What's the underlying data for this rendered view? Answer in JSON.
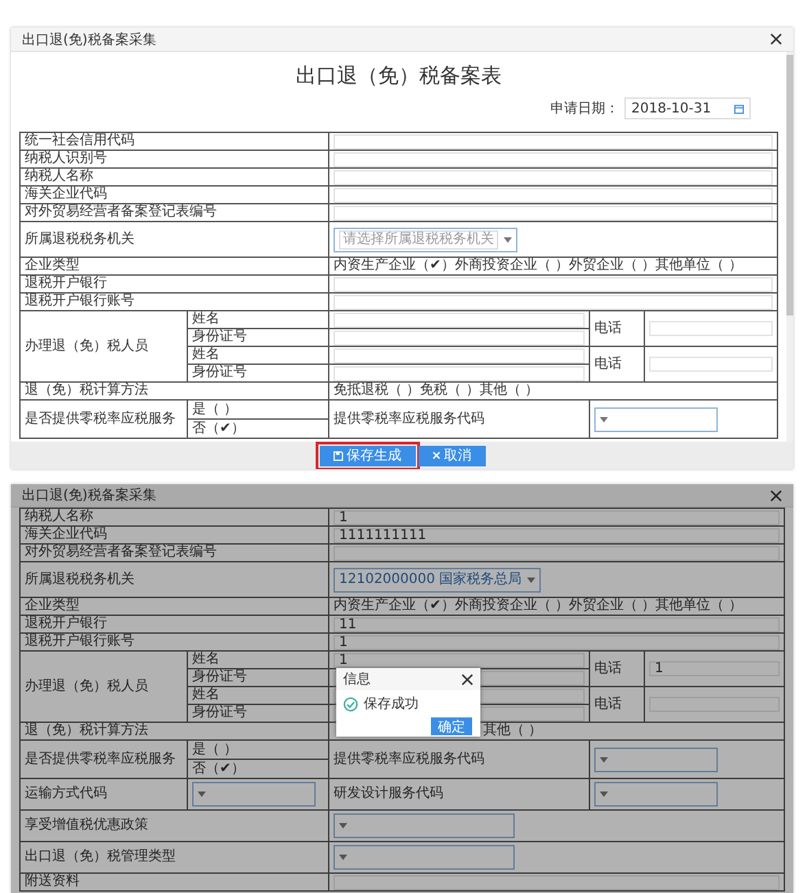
{
  "upper": {
    "dialog_title": "出口退(免)税备案采集",
    "heading": "出口退（免）税备案表",
    "date_label": "申请日期：",
    "date_value": "2018-10-31",
    "rows": [
      {
        "kind": "text",
        "label": "统一社会信用代码"
      },
      {
        "kind": "text",
        "label": "纳税人识别号"
      },
      {
        "kind": "text",
        "label": "纳税人名称"
      },
      {
        "kind": "text",
        "label": "海关企业代码"
      },
      {
        "kind": "text",
        "label": "对外贸易经营者备案登记表编号"
      },
      {
        "kind": "select",
        "label": "所属退税税务机关",
        "placeholder": "请选择所属退税税务机关"
      },
      {
        "kind": "choice",
        "label": "企业类型",
        "value": "内资生产企业（✔）外商投资企业（ ）外贸企业（ ）其他单位（ ）"
      },
      {
        "kind": "text",
        "label": "退税开户银行"
      },
      {
        "kind": "text",
        "label": "退税开户银行账号"
      },
      {
        "kind": "persons",
        "label": "办理退（免）税人员",
        "people": [
          {
            "fields": [
              {
                "label": "姓名"
              },
              {
                "label": "身份证号"
              }
            ],
            "phone_label": "电话"
          },
          {
            "fields": [
              {
                "label": "姓名"
              },
              {
                "label": "身份证号"
              }
            ],
            "phone_label": "电话"
          }
        ]
      },
      {
        "kind": "choice",
        "label": "退（免）税计算方法",
        "value": "免抵退税（ ）免税（ ）其他（ ）"
      },
      {
        "kind": "yesno",
        "label": "是否提供零税率应税服务",
        "options": [
          "是（ ）",
          "否（✔）"
        ],
        "right_label": "提供零税率应税服务代码"
      }
    ],
    "buttons": [
      {
        "label": "保存生成",
        "kind": "save",
        "highlighted": true
      },
      {
        "label": "取消",
        "kind": "cancel",
        "highlighted": false
      }
    ]
  },
  "lower": {
    "dialog_title": "出口退(免)税备案采集",
    "rows": [
      {
        "kind": "text",
        "label": "纳税人名称",
        "value": "1"
      },
      {
        "kind": "text",
        "label": "海关企业代码",
        "value": "1111111111"
      },
      {
        "kind": "text",
        "label": "对外贸易经营者备案登记表编号"
      },
      {
        "kind": "select",
        "label": "所属退税税务机关",
        "value": "12102000000 国家税务总局"
      },
      {
        "kind": "choice",
        "label": "企业类型",
        "value": "内资生产企业（✔）外商投资企业（ ）外贸企业（ ）其他单位（ ）"
      },
      {
        "kind": "text",
        "label": "退税开户银行",
        "value": "11"
      },
      {
        "kind": "text",
        "label": "退税开户银行账号",
        "value": "1"
      },
      {
        "kind": "persons",
        "label": "办理退（免）税人员",
        "people": [
          {
            "fields": [
              {
                "label": "姓名",
                "value": "1"
              },
              {
                "label": "身份证号"
              }
            ],
            "phone_label": "电话",
            "phone_value": "1"
          },
          {
            "fields": [
              {
                "label": "姓名"
              },
              {
                "label": "身份证号"
              }
            ],
            "phone_label": "电话"
          }
        ]
      },
      {
        "kind": "covered_choice",
        "label": "退（免）税计算方法",
        "value": "其他（ ）"
      },
      {
        "kind": "yesno",
        "label": "是否提供零税率应税服务",
        "options": [
          "是（ ）",
          "否（✔）"
        ],
        "right_label": "提供零税率应税服务代码"
      },
      {
        "kind": "pair_select",
        "label": "运输方式代码",
        "right_label": "研发设计服务代码"
      },
      {
        "kind": "select",
        "label": "享受增值税优惠政策"
      },
      {
        "kind": "select",
        "label": "出口退（免）税管理类型"
      },
      {
        "kind": "text",
        "label": "附送资料"
      }
    ],
    "message": {
      "title": "信息",
      "text": "保存成功",
      "button": "确定"
    }
  }
}
